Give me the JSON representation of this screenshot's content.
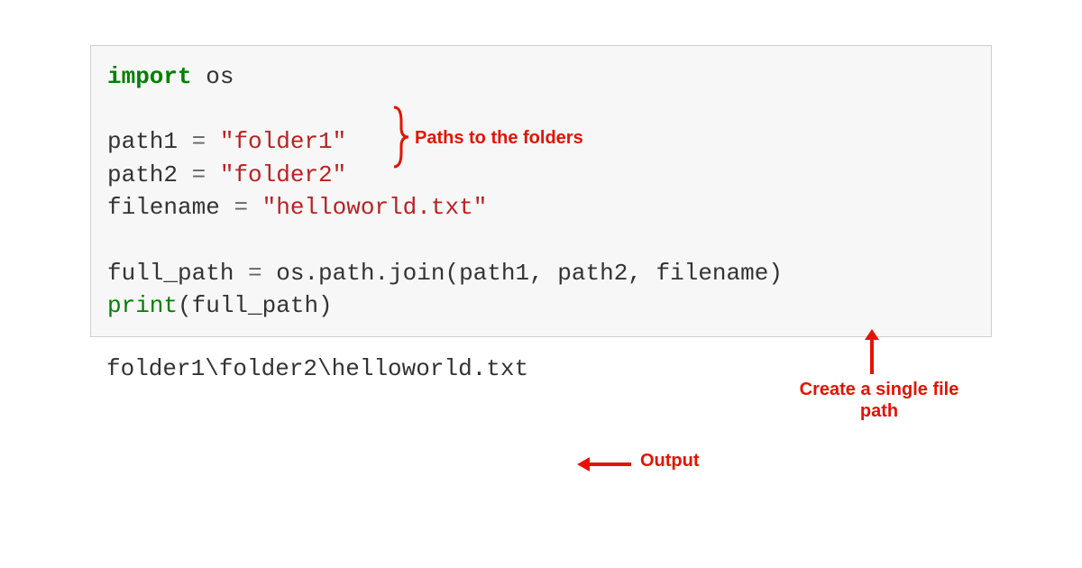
{
  "code": {
    "line1_import": "import",
    "line1_os": " os",
    "line3_var": "path1 ",
    "line3_op": "=",
    "line3_str": " \"folder1\"",
    "line4_var": "path2 ",
    "line4_op": "=",
    "line4_str": " \"folder2\"",
    "line5_var": "filename ",
    "line5_op": "=",
    "line5_str": " \"helloworld.txt\"",
    "line7_var": "full_path ",
    "line7_op": "=",
    "line7_rest": " os.path.join(path1, path2, filename)",
    "line8_print": "print",
    "line8_rest": "(full_path)"
  },
  "output": "folder1\\folder2\\helloworld.txt",
  "annotations": {
    "paths": "Paths to the folders",
    "create": "Create a single file path",
    "output": "Output"
  },
  "colors": {
    "annotation_red": "#e31300",
    "keyword_green": "#008000",
    "string_maroon": "#ba2121",
    "code_bg": "#f7f7f7",
    "code_border": "#cfcfcf"
  }
}
